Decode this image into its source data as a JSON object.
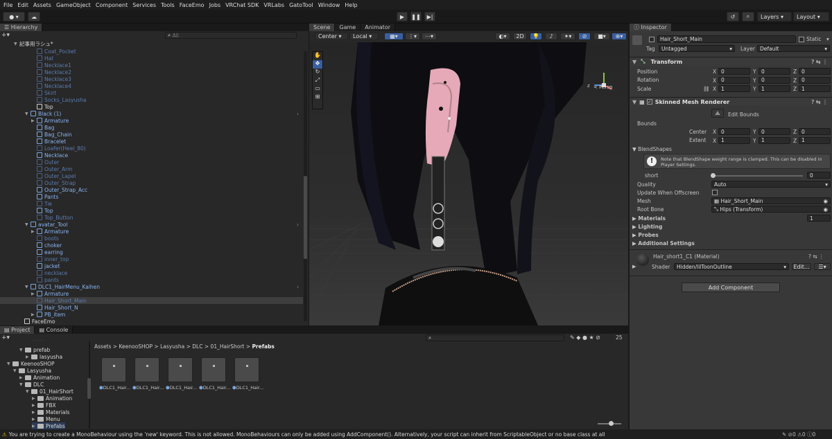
{
  "menu": [
    "File",
    "Edit",
    "Assets",
    "GameObject",
    "Component",
    "Services",
    "Tools",
    "FaceEmo",
    "Jobs",
    "VRChat SDK",
    "VRLabs",
    "GatoTool",
    "Window",
    "Help"
  ],
  "toolbar": {
    "layers": "Layers",
    "layout": "Layout"
  },
  "hierarchy": {
    "tab": "Hierarchy",
    "search_placeholder": "All",
    "scene": "記事用ラシュ*",
    "rows": [
      {
        "label": "Coat_Pocket",
        "indent": 3,
        "style": "dim",
        "arrow": ""
      },
      {
        "label": "Hat",
        "indent": 3,
        "style": "dim",
        "arrow": ""
      },
      {
        "label": "Necklace1",
        "indent": 3,
        "style": "dim",
        "arrow": ""
      },
      {
        "label": "Necklace2",
        "indent": 3,
        "style": "dim",
        "arrow": ""
      },
      {
        "label": "Necklace3",
        "indent": 3,
        "style": "dim",
        "arrow": ""
      },
      {
        "label": "Necklace4",
        "indent": 3,
        "style": "dim",
        "arrow": ""
      },
      {
        "label": "Skirt",
        "indent": 3,
        "style": "dim",
        "arrow": ""
      },
      {
        "label": "Socks_Lasyusha",
        "indent": 3,
        "style": "dim",
        "arrow": ""
      },
      {
        "label": "Top",
        "indent": 3,
        "style": "lt",
        "arrow": ""
      },
      {
        "label": "Black (1)",
        "indent": 2,
        "style": "hl",
        "arrow": "▼"
      },
      {
        "label": "Armature",
        "indent": 3,
        "style": "hl",
        "arrow": "▶"
      },
      {
        "label": "Bag",
        "indent": 3,
        "style": "hl",
        "arrow": ""
      },
      {
        "label": "Bag_Chain",
        "indent": 3,
        "style": "hl",
        "arrow": ""
      },
      {
        "label": "Bracelet",
        "indent": 3,
        "style": "hl",
        "arrow": ""
      },
      {
        "label": "Loafer(Heel_80)",
        "indent": 3,
        "style": "dim",
        "arrow": ""
      },
      {
        "label": "Necklace",
        "indent": 3,
        "style": "hl",
        "arrow": ""
      },
      {
        "label": "Outer",
        "indent": 3,
        "style": "dim",
        "arrow": ""
      },
      {
        "label": "Outer_Arm",
        "indent": 3,
        "style": "dim",
        "arrow": ""
      },
      {
        "label": "Outer_Lapel",
        "indent": 3,
        "style": "dim",
        "arrow": ""
      },
      {
        "label": "Outer_Strap",
        "indent": 3,
        "style": "dim",
        "arrow": ""
      },
      {
        "label": "Outer_Strap_Acc",
        "indent": 3,
        "style": "hl",
        "arrow": ""
      },
      {
        "label": "Pants",
        "indent": 3,
        "style": "hl",
        "arrow": ""
      },
      {
        "label": "Tie",
        "indent": 3,
        "style": "dim",
        "arrow": ""
      },
      {
        "label": "Top",
        "indent": 3,
        "style": "hl",
        "arrow": ""
      },
      {
        "label": "Top_Button",
        "indent": 3,
        "style": "dim",
        "arrow": ""
      },
      {
        "label": "avatar_Tool",
        "indent": 2,
        "style": "hl",
        "arrow": "▼"
      },
      {
        "label": "Armature",
        "indent": 3,
        "style": "hl",
        "arrow": "▶"
      },
      {
        "label": "boots",
        "indent": 3,
        "style": "dim",
        "arrow": ""
      },
      {
        "label": "choker",
        "indent": 3,
        "style": "hl",
        "arrow": ""
      },
      {
        "label": "earring",
        "indent": 3,
        "style": "hl",
        "arrow": ""
      },
      {
        "label": "inner_top",
        "indent": 3,
        "style": "dim",
        "arrow": ""
      },
      {
        "label": "jacket",
        "indent": 3,
        "style": "hl",
        "arrow": ""
      },
      {
        "label": "necklace",
        "indent": 3,
        "style": "dim",
        "arrow": ""
      },
      {
        "label": "pants",
        "indent": 3,
        "style": "dim",
        "arrow": ""
      },
      {
        "label": "DLC1_HairMenu_Kaihen",
        "indent": 2,
        "style": "hl",
        "arrow": "▼"
      },
      {
        "label": "Armature",
        "indent": 3,
        "style": "hl",
        "arrow": "▶"
      },
      {
        "label": "Hair_Short_Main",
        "indent": 3,
        "style": "dim",
        "arrow": ""
      },
      {
        "label": "Hair_Short_N",
        "indent": 3,
        "style": "hl",
        "arrow": ""
      },
      {
        "label": "PB_item",
        "indent": 3,
        "style": "hl",
        "arrow": "▶"
      },
      {
        "label": "FaceEmo",
        "indent": 1,
        "style": "lt",
        "arrow": ""
      }
    ]
  },
  "scene": {
    "tabs": [
      "Scene",
      "Game",
      "Animator"
    ],
    "center": "Center",
    "local": "Local",
    "two_d": "2D",
    "persp": "< Persp"
  },
  "inspector": {
    "tab": "Inspector",
    "object_name": "Hair_Short_Main",
    "static": "Static",
    "tag_label": "Tag",
    "tag_value": "Untagged",
    "layer_label": "Layer",
    "layer_value": "Default",
    "transform": "Transform",
    "position": "Position",
    "rotation": "Rotation",
    "scale": "Scale",
    "pos": [
      "0",
      "0",
      "0"
    ],
    "rot": [
      "0",
      "0",
      "0"
    ],
    "scl": [
      "1",
      "1",
      "1"
    ],
    "smr": "Skinned Mesh Renderer",
    "edit_bounds": "Edit Bounds",
    "bounds": "Bounds",
    "center": "Center",
    "extent": "Extent",
    "ctr": [
      "0",
      "0",
      "0"
    ],
    "ext": [
      "1",
      "1",
      "1"
    ],
    "blendshapes": "BlendShapes",
    "note": "Note that BlendShape weight range is clamped. This can be disabled in Player Settings.",
    "short_label": "short",
    "short_value": "0",
    "quality_label": "Quality",
    "quality_value": "Auto",
    "update_offscreen": "Update When Offscreen",
    "mesh_label": "Mesh",
    "mesh_value": "Hair_Short_Main",
    "root_label": "Root Bone",
    "root_value": "Hips (Transform)",
    "materials": "Materials",
    "materials_count": "1",
    "lighting": "Lighting",
    "probes": "Probes",
    "additional": "Additional Settings",
    "material_name": "Hair_short1_C1 (Material)",
    "shader_label": "Shader",
    "shader_value": "Hidden/lilToonOutline",
    "edit": "Edit...",
    "add_component": "Add Component"
  },
  "project": {
    "tabs": [
      "Project",
      "Console"
    ],
    "breadcrumb": [
      "Assets",
      "KeenooSHOP",
      "Lasyusha",
      "DLC",
      "01_HairShort",
      "Prefabs"
    ],
    "count": "25",
    "tree": [
      {
        "label": "prefab",
        "indent": 2
      },
      {
        "label": "lasyusha",
        "indent": 3
      },
      {
        "label": "KeenooSHOP",
        "indent": 0
      },
      {
        "label": "Lasyusha",
        "indent": 1
      },
      {
        "label": "Animation",
        "indent": 2
      },
      {
        "label": "DLC",
        "indent": 2
      },
      {
        "label": "01_HairShort",
        "indent": 3
      },
      {
        "label": "Animation",
        "indent": 4
      },
      {
        "label": "FBX",
        "indent": 4
      },
      {
        "label": "Materials",
        "indent": 4
      },
      {
        "label": "Menu",
        "indent": 4
      },
      {
        "label": "Prefabs",
        "indent": 4
      }
    ],
    "assets": [
      "DLC1_Hair...",
      "DLC1_Hair...",
      "DLC1_Hair...",
      "DLC1_Hair...",
      "DLC1_Hair..."
    ]
  },
  "status": "You are trying to create a MonoBehaviour using the 'new' keyword.  This is not allowed.  MonoBehaviours can only be added using AddComponent(). Alternatively, your script can inherit from ScriptableObject or no base class at all"
}
